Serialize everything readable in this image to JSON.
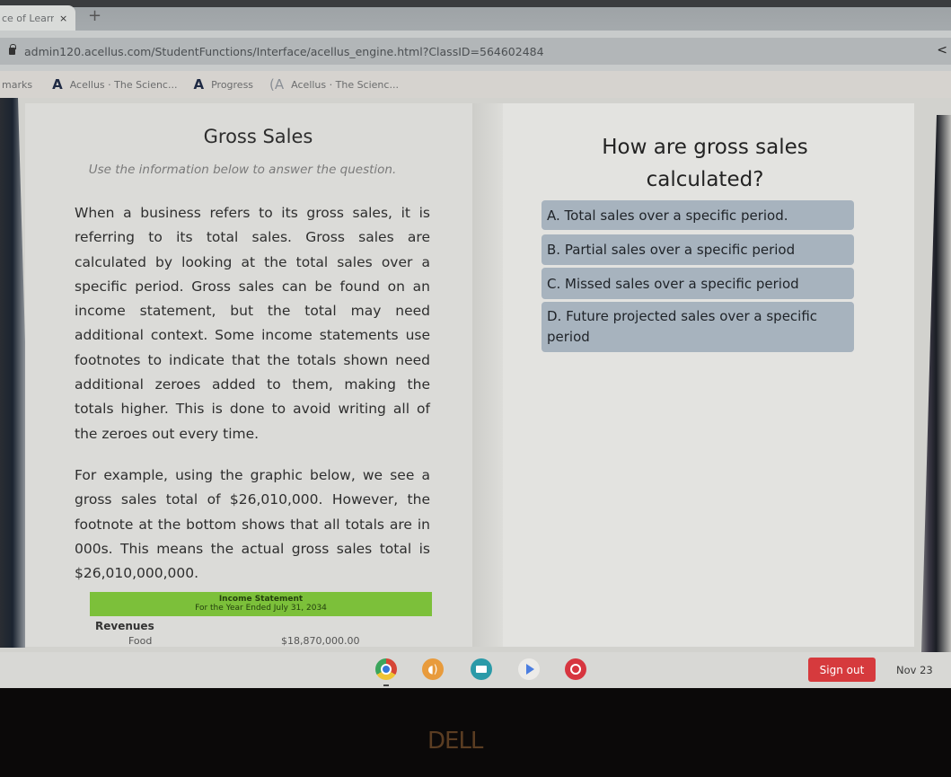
{
  "browser": {
    "tab_title": "ce of Learning",
    "tab_close": "×",
    "new_tab": "+",
    "url": "admin120.acellus.com/StudentFunctions/Interface/acellus_engine.html?ClassID=564602484",
    "back_glyph": "<",
    "bookmarks_label": "marks",
    "bookmarks": [
      {
        "icon": "acellus-logo-icon",
        "glyph": "A",
        "label": "Acellus · The Scienc..."
      },
      {
        "icon": "acellus-logo-icon",
        "glyph": "A",
        "label": "Progress"
      },
      {
        "icon": "acellus-outline-logo-icon",
        "glyph": "(A",
        "label": "Acellus · The Scienc..."
      }
    ]
  },
  "lesson": {
    "title": "Gross Sales",
    "subtitle": "Use the information below to answer the question.",
    "paragraph1": "When a business refers to its gross sales, it is referring to its total sales. Gross sales are calculated by looking at the total sales over a specific period. Gross sales can be found on an income statement, but the total may need additional context. Some income statements use footnotes to indicate that the totals shown need additional zeroes added to them, making the totals higher. This is done to avoid writing all of the zeroes out every time.",
    "paragraph2": "For example, using the graphic below, we see a gross sales total of $26,010,000. However, the footnote at the bottom shows that all totals are in 000s. This means the actual gross sales total is $26,010,000,000.",
    "statement": {
      "title": "Income Statement",
      "period": "For the Year Ended July 31, 2034",
      "section": "Revenues",
      "rows": [
        {
          "label": "Food",
          "amount": "$18,870,000.00"
        }
      ],
      "header_color": "#7cc03a"
    }
  },
  "question": {
    "prompt": "How are gross sales calculated?",
    "answers": [
      {
        "letter": "A",
        "text": "A. Total sales over a specific period."
      },
      {
        "letter": "B",
        "text": "B. Partial sales over a specific period"
      },
      {
        "letter": "C",
        "text": "C. Missed sales over a specific period"
      },
      {
        "letter": "D",
        "text": "D. Future projected sales over a specific period"
      }
    ],
    "answer_color": "#a7b3be"
  },
  "shelf": {
    "apps": [
      {
        "name": "chrome",
        "icon": "chrome-icon"
      },
      {
        "name": "audio",
        "icon": "speaker-icon",
        "glyph": "◖)"
      },
      {
        "name": "screen",
        "icon": "screen-app-icon"
      },
      {
        "name": "play-store",
        "icon": "play-store-icon"
      },
      {
        "name": "paint",
        "icon": "paint-palette-icon"
      }
    ],
    "sign_out": "Sign out",
    "date": "Nov 23",
    "sign_out_color": "#d63a3d"
  },
  "hardware": {
    "brand": "DELL"
  }
}
